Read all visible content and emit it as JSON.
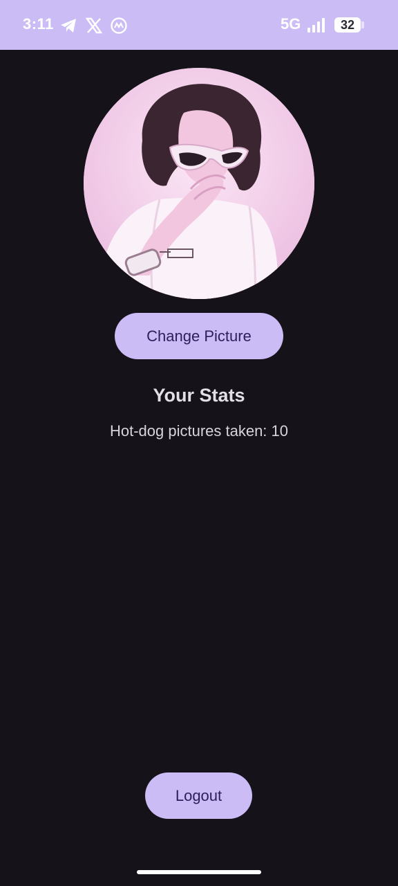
{
  "status_bar": {
    "time": "3:11",
    "network": "5G",
    "battery": "32",
    "icons": [
      "telegram-icon",
      "x-icon",
      "coinmarketcap-icon",
      "signal-icon",
      "battery-icon"
    ],
    "background_color": "#cbbcf6"
  },
  "profile": {
    "avatar_description_icon": "profile-photo"
  },
  "actions": {
    "change_picture_label": "Change Picture",
    "logout_label": "Logout"
  },
  "stats": {
    "title": "Your Stats",
    "hotdog_line": "Hot-dog pictures taken: 10"
  },
  "colors": {
    "background": "#16121a",
    "button": "#cbbcf6",
    "button_text": "#2d1d5c",
    "text": "#e2dfe6"
  }
}
